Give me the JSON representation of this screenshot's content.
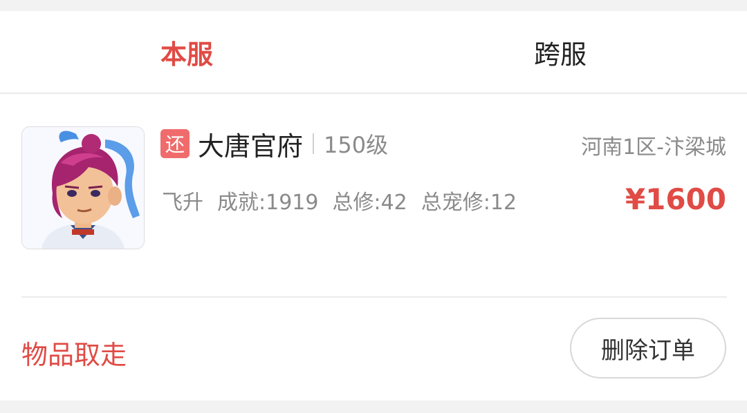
{
  "tabs": [
    {
      "label": "本服",
      "active": true
    },
    {
      "label": "跨服",
      "active": false
    }
  ],
  "order": {
    "badge": "还",
    "name": "大唐官府",
    "level": "150级",
    "server": "河南1区-汴梁城",
    "stats": [
      "飞升",
      "成就:1919",
      "总修:42",
      "总宠修:12"
    ],
    "price": "¥1600",
    "status": "物品取走",
    "action_label": "删除订单"
  },
  "colors": {
    "accent": "#e04b45",
    "badge": "#f06b6b",
    "muted_text": "#8a8a8a"
  },
  "icons": {
    "avatar": "character-portrait"
  }
}
